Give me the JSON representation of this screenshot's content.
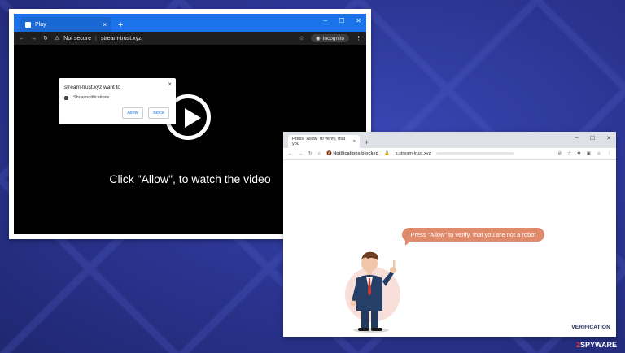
{
  "window1": {
    "tab_title": "Play",
    "tab_close": "×",
    "new_tab": "+",
    "window_controls": [
      "–",
      "☐",
      "✕"
    ],
    "nav": [
      "←",
      "→",
      "↻"
    ],
    "security_label": "Not secure",
    "address": "stream-trust.xyz",
    "star": "☆",
    "profile": "Incognito",
    "menu": "⋮",
    "cta": "Click \"Allow\", to watch the video",
    "popup": {
      "title": "stream-trust.xyz want to",
      "close": "×",
      "permission": "Show notifications",
      "allow": "Allow",
      "block": "Block"
    }
  },
  "window2": {
    "tab_title": "Press \"Allow\" to verify, that you",
    "tab_close": "×",
    "new_tab": "+",
    "window_controls": [
      "–",
      "☐",
      "✕"
    ],
    "nav": [
      "←",
      "→",
      "↻",
      "⌂"
    ],
    "notifications_label": "Notifications blocked",
    "address": "s.stream-trust.xyz",
    "toolbar_icons": [
      "⊘",
      "☆",
      "✱",
      "▣",
      "☺",
      "⋮"
    ],
    "speech": "Press \"Allow\" to verify, that you are not a robot",
    "footer": "VERIFICATION"
  },
  "brand": {
    "prefix": "2",
    "rest": "SPYWARE",
    "accent": "#e33"
  }
}
